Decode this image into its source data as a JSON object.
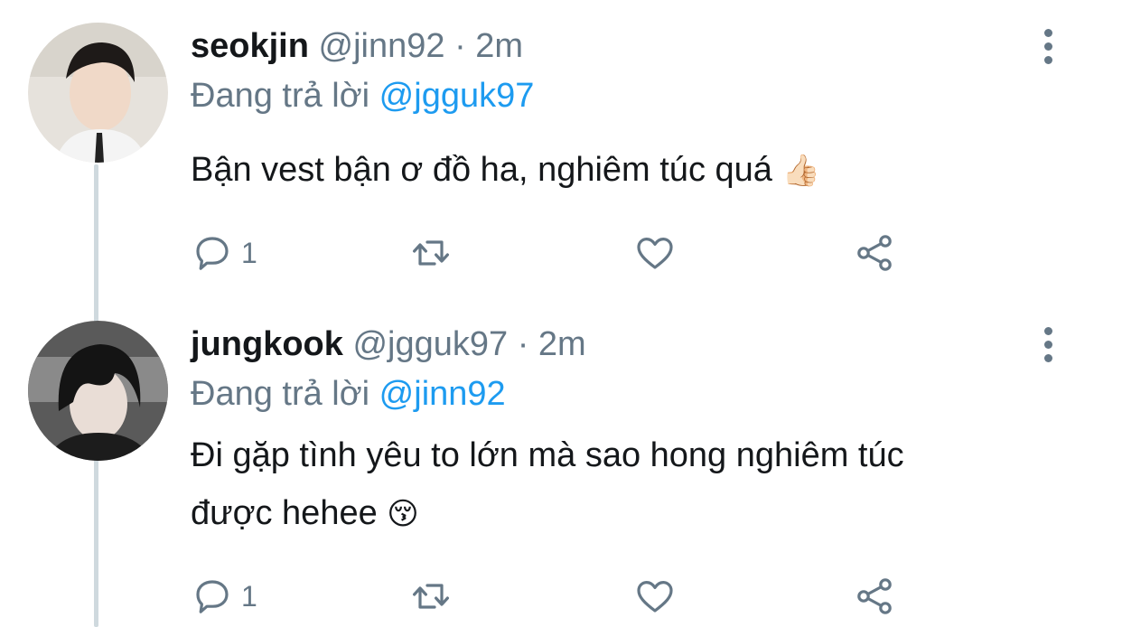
{
  "tweets": [
    {
      "display_name": "seokjin",
      "handle": "@jinn92",
      "separator": "·",
      "time": "2m",
      "reply_prefix": "Đang trả lời",
      "reply_to": "@jgguk97",
      "text": "Bận vest bận ơ đồ ha, nghiêm túc quá",
      "emoji": "👍🏻",
      "reply_count": "1",
      "avatar_icon": "avatar-photo"
    },
    {
      "display_name": "jungkook",
      "handle": "@jgguk97",
      "separator": "·",
      "time": "2m",
      "reply_prefix": "Đang trả lời",
      "reply_to": "@jinn92",
      "text_line1": "Đi gặp tình yêu to lớn mà sao hong nghiêm túc",
      "text_line2": "được hehee",
      "emoji": "😚",
      "reply_count": "1",
      "avatar_icon": "avatar-photo"
    }
  ],
  "icons": {
    "reply": "speech-bubble-icon",
    "retweet": "retweet-arrows-icon",
    "like": "heart-outline-icon",
    "share": "share-nodes-icon",
    "more": "vertical-ellipsis-icon"
  },
  "colors": {
    "link": "#1d9bf0",
    "secondary": "#657786",
    "thread_line": "#cfd9de",
    "text": "#14171a"
  }
}
